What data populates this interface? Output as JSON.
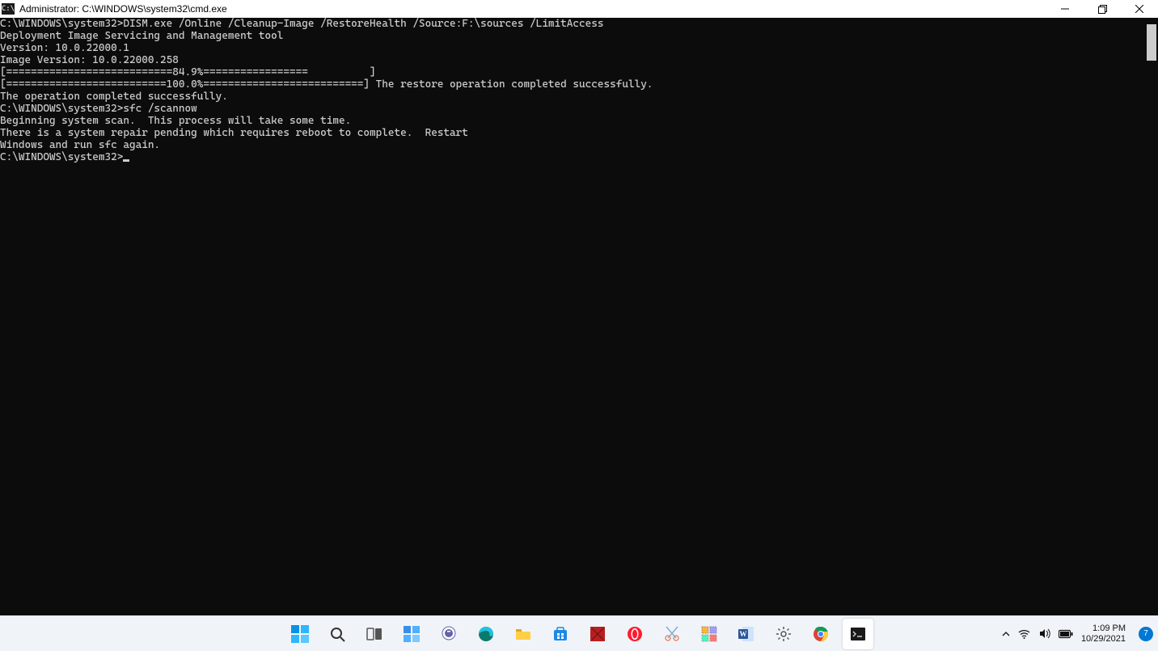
{
  "window": {
    "icon_label": "C:\\",
    "title": "Administrator: C:\\WINDOWS\\system32\\cmd.exe"
  },
  "terminal": {
    "lines": [
      "C:\\WINDOWS\\system32>DISM.exe /Online /Cleanup-Image /RestoreHealth /Source:F:\\sources /LimitAccess",
      "",
      "Deployment Image Servicing and Management tool",
      "Version: 10.0.22000.1",
      "",
      "Image Version: 10.0.22000.258",
      "",
      "[===========================84.9%=================          ]",
      "[==========================100.0%==========================] The restore operation completed successfully.",
      "The operation completed successfully.",
      "",
      "C:\\WINDOWS\\system32>sfc /scannow",
      "",
      "Beginning system scan.  This process will take some time.",
      "",
      "",
      "There is a system repair pending which requires reboot to complete.  Restart",
      "Windows and run sfc again.",
      "",
      "C:\\WINDOWS\\system32>"
    ]
  },
  "taskbar": {
    "items": [
      {
        "name": "start",
        "label": "Start"
      },
      {
        "name": "search",
        "label": "Search"
      },
      {
        "name": "task-view",
        "label": "Task View"
      },
      {
        "name": "widgets",
        "label": "Widgets"
      },
      {
        "name": "chat",
        "label": "Chat"
      },
      {
        "name": "edge",
        "label": "Microsoft Edge"
      },
      {
        "name": "file-explorer",
        "label": "File Explorer"
      },
      {
        "name": "microsoft-store",
        "label": "Microsoft Store"
      },
      {
        "name": "app-red",
        "label": "App"
      },
      {
        "name": "opera",
        "label": "Opera"
      },
      {
        "name": "snip",
        "label": "Snip & Sketch"
      },
      {
        "name": "app-grid",
        "label": "App"
      },
      {
        "name": "word",
        "label": "Word"
      },
      {
        "name": "settings",
        "label": "Settings"
      },
      {
        "name": "chrome",
        "label": "Chrome"
      },
      {
        "name": "cmd",
        "label": "Command Prompt"
      }
    ]
  },
  "tray": {
    "time": "1:09 PM",
    "date": "10/29/2021",
    "badge": "7"
  }
}
